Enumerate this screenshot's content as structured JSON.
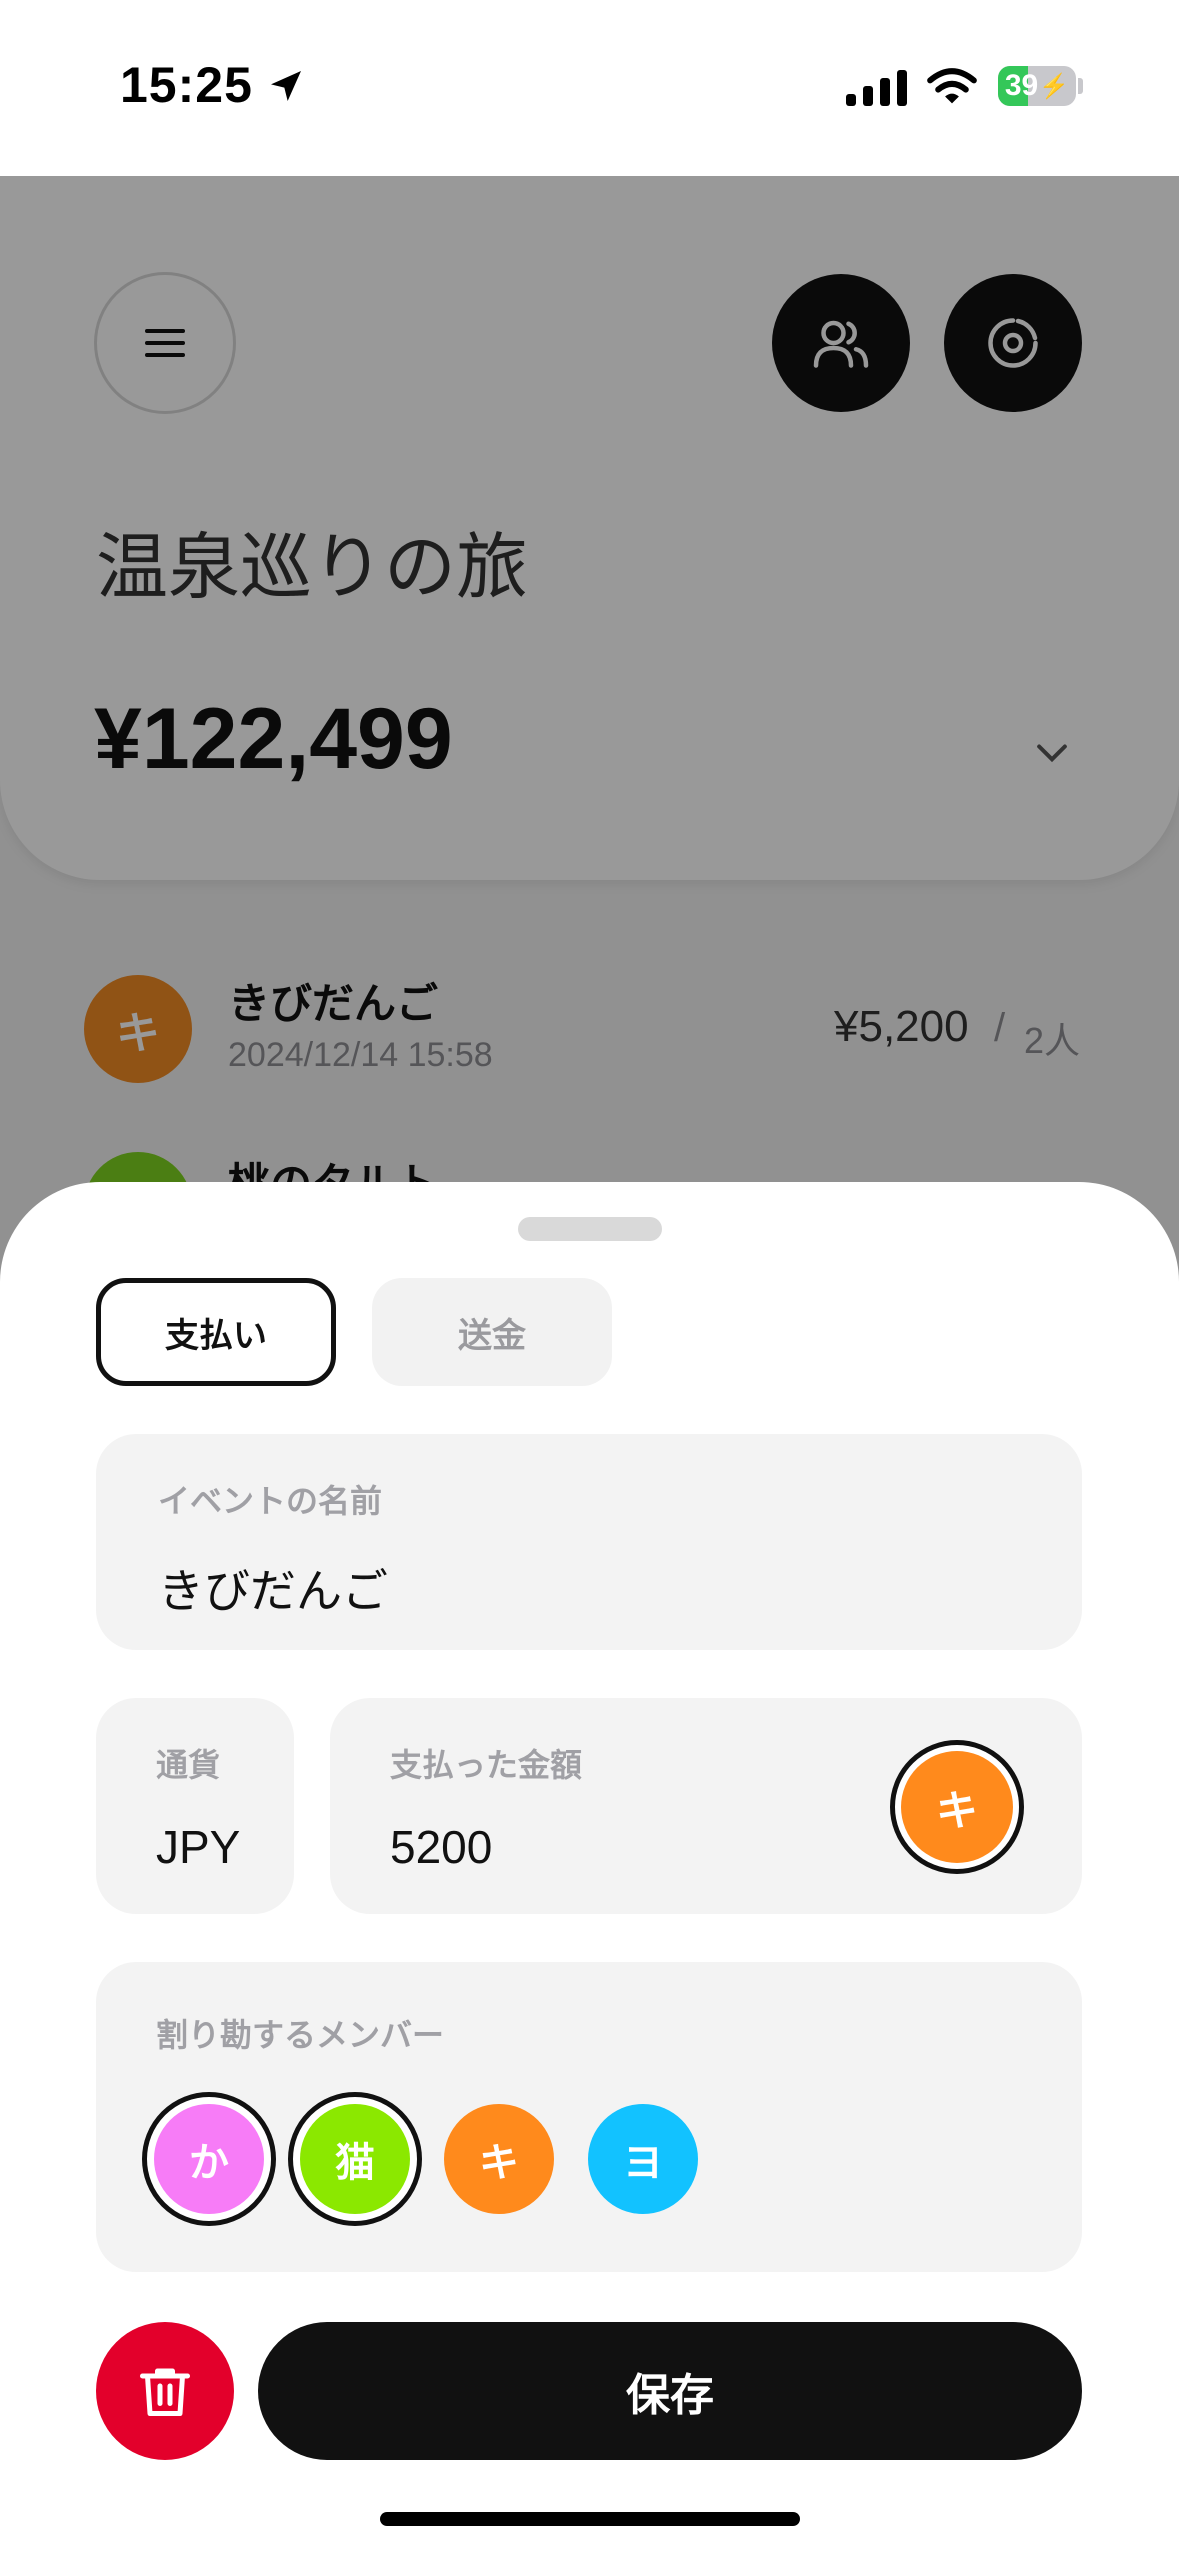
{
  "status_bar": {
    "time": "15:25",
    "battery": "39",
    "battery_level": 0.39
  },
  "header": {
    "trip_title": "温泉巡りの旅",
    "total": "¥122,499"
  },
  "expenses": [
    {
      "initial": "キ",
      "name": "きびだんご",
      "date": "2024/12/14 15:58",
      "amount": "¥5,200",
      "slash": "/",
      "people": "2人"
    },
    {
      "initial": "",
      "name": "桃のタルト"
    }
  ],
  "sheet": {
    "tabs": {
      "payment": "支払い",
      "transfer": "送金"
    },
    "event_name": {
      "label": "イベントの名前",
      "value": "きびだんご"
    },
    "currency": {
      "label": "通貨",
      "value": "JPY"
    },
    "amount": {
      "label": "支払った金額",
      "value": "5200"
    },
    "payer_initial": "キ",
    "members": {
      "label": "割り勘するメンバー",
      "items": [
        {
          "initial": "か",
          "color": "#f77cf7",
          "selected": true
        },
        {
          "initial": "猫",
          "color": "#8be800",
          "selected": true
        },
        {
          "initial": "キ",
          "color": "#ff8a1c",
          "selected": false
        },
        {
          "initial": "ヨ",
          "color": "#12c2ff",
          "selected": false
        }
      ]
    },
    "save_label": "保存"
  },
  "colors": {
    "delete": "#e3002b",
    "payer": "#ff8a1c"
  }
}
